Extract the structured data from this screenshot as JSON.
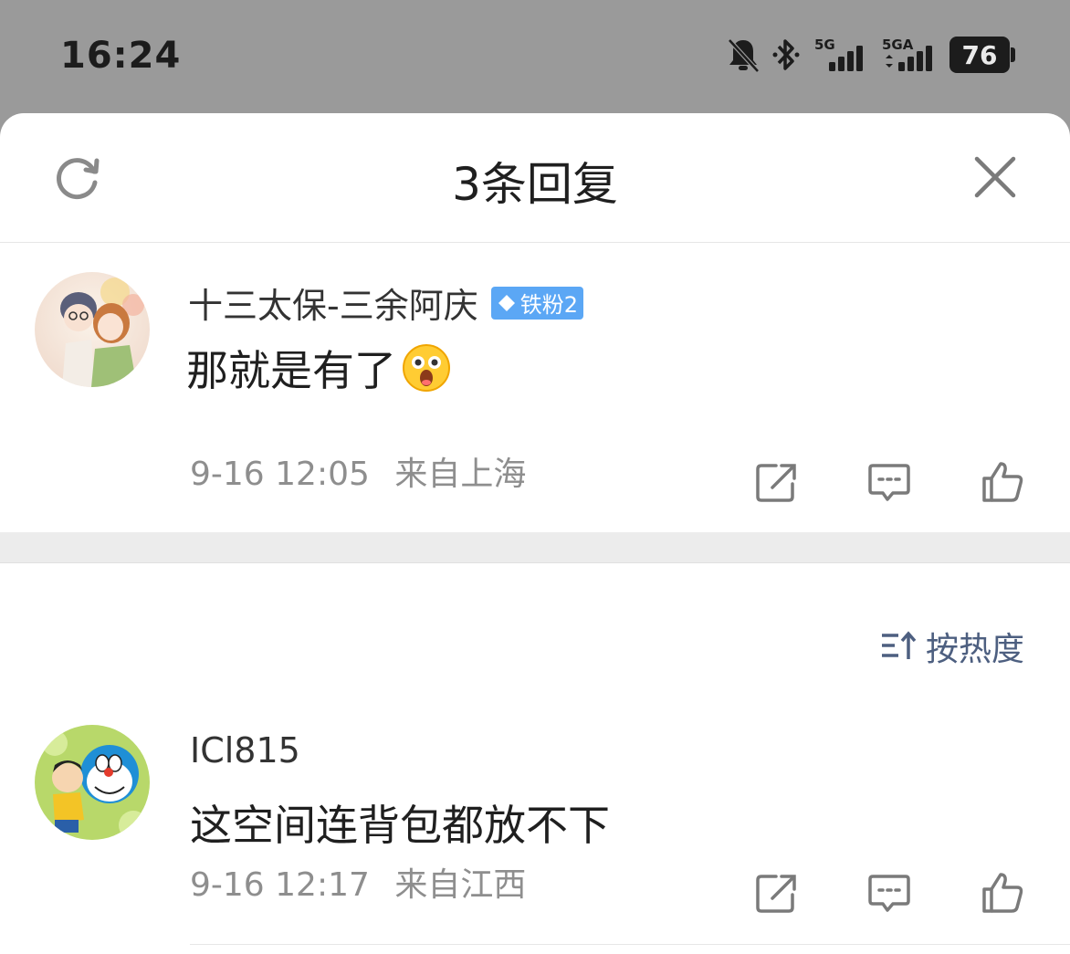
{
  "status_bar": {
    "time": "16:24",
    "battery": "76",
    "network_1": "5G",
    "network_2": "5GA",
    "icons": [
      "bell-off-icon",
      "bluetooth-icon",
      "signal-5g-icon",
      "signal-5ga-icon",
      "battery-icon"
    ]
  },
  "sheet": {
    "title": "3条回复",
    "refresh_icon": "refresh-icon",
    "close_icon": "close-icon"
  },
  "main_comment": {
    "author": "十三太保-三余阿庆",
    "badge": "铁粉2",
    "text": "那就是有了",
    "emoji": "😲",
    "date": "9-16 12:05",
    "location": "来自上海"
  },
  "sort": {
    "label": "按热度",
    "icon": "sort-icon"
  },
  "replies": [
    {
      "author": "ICl815",
      "text": "这空间连背包都放不下",
      "date": "9-16 12:17",
      "location": "来自江西"
    }
  ],
  "action_icons": [
    "share-icon",
    "comment-icon",
    "like-icon"
  ],
  "colors": {
    "status_bg": "#9a9a9a",
    "badge_blue": "#5ba7f5",
    "meta_gray": "#8e8e8e",
    "sort_blue": "#4d5f80"
  }
}
